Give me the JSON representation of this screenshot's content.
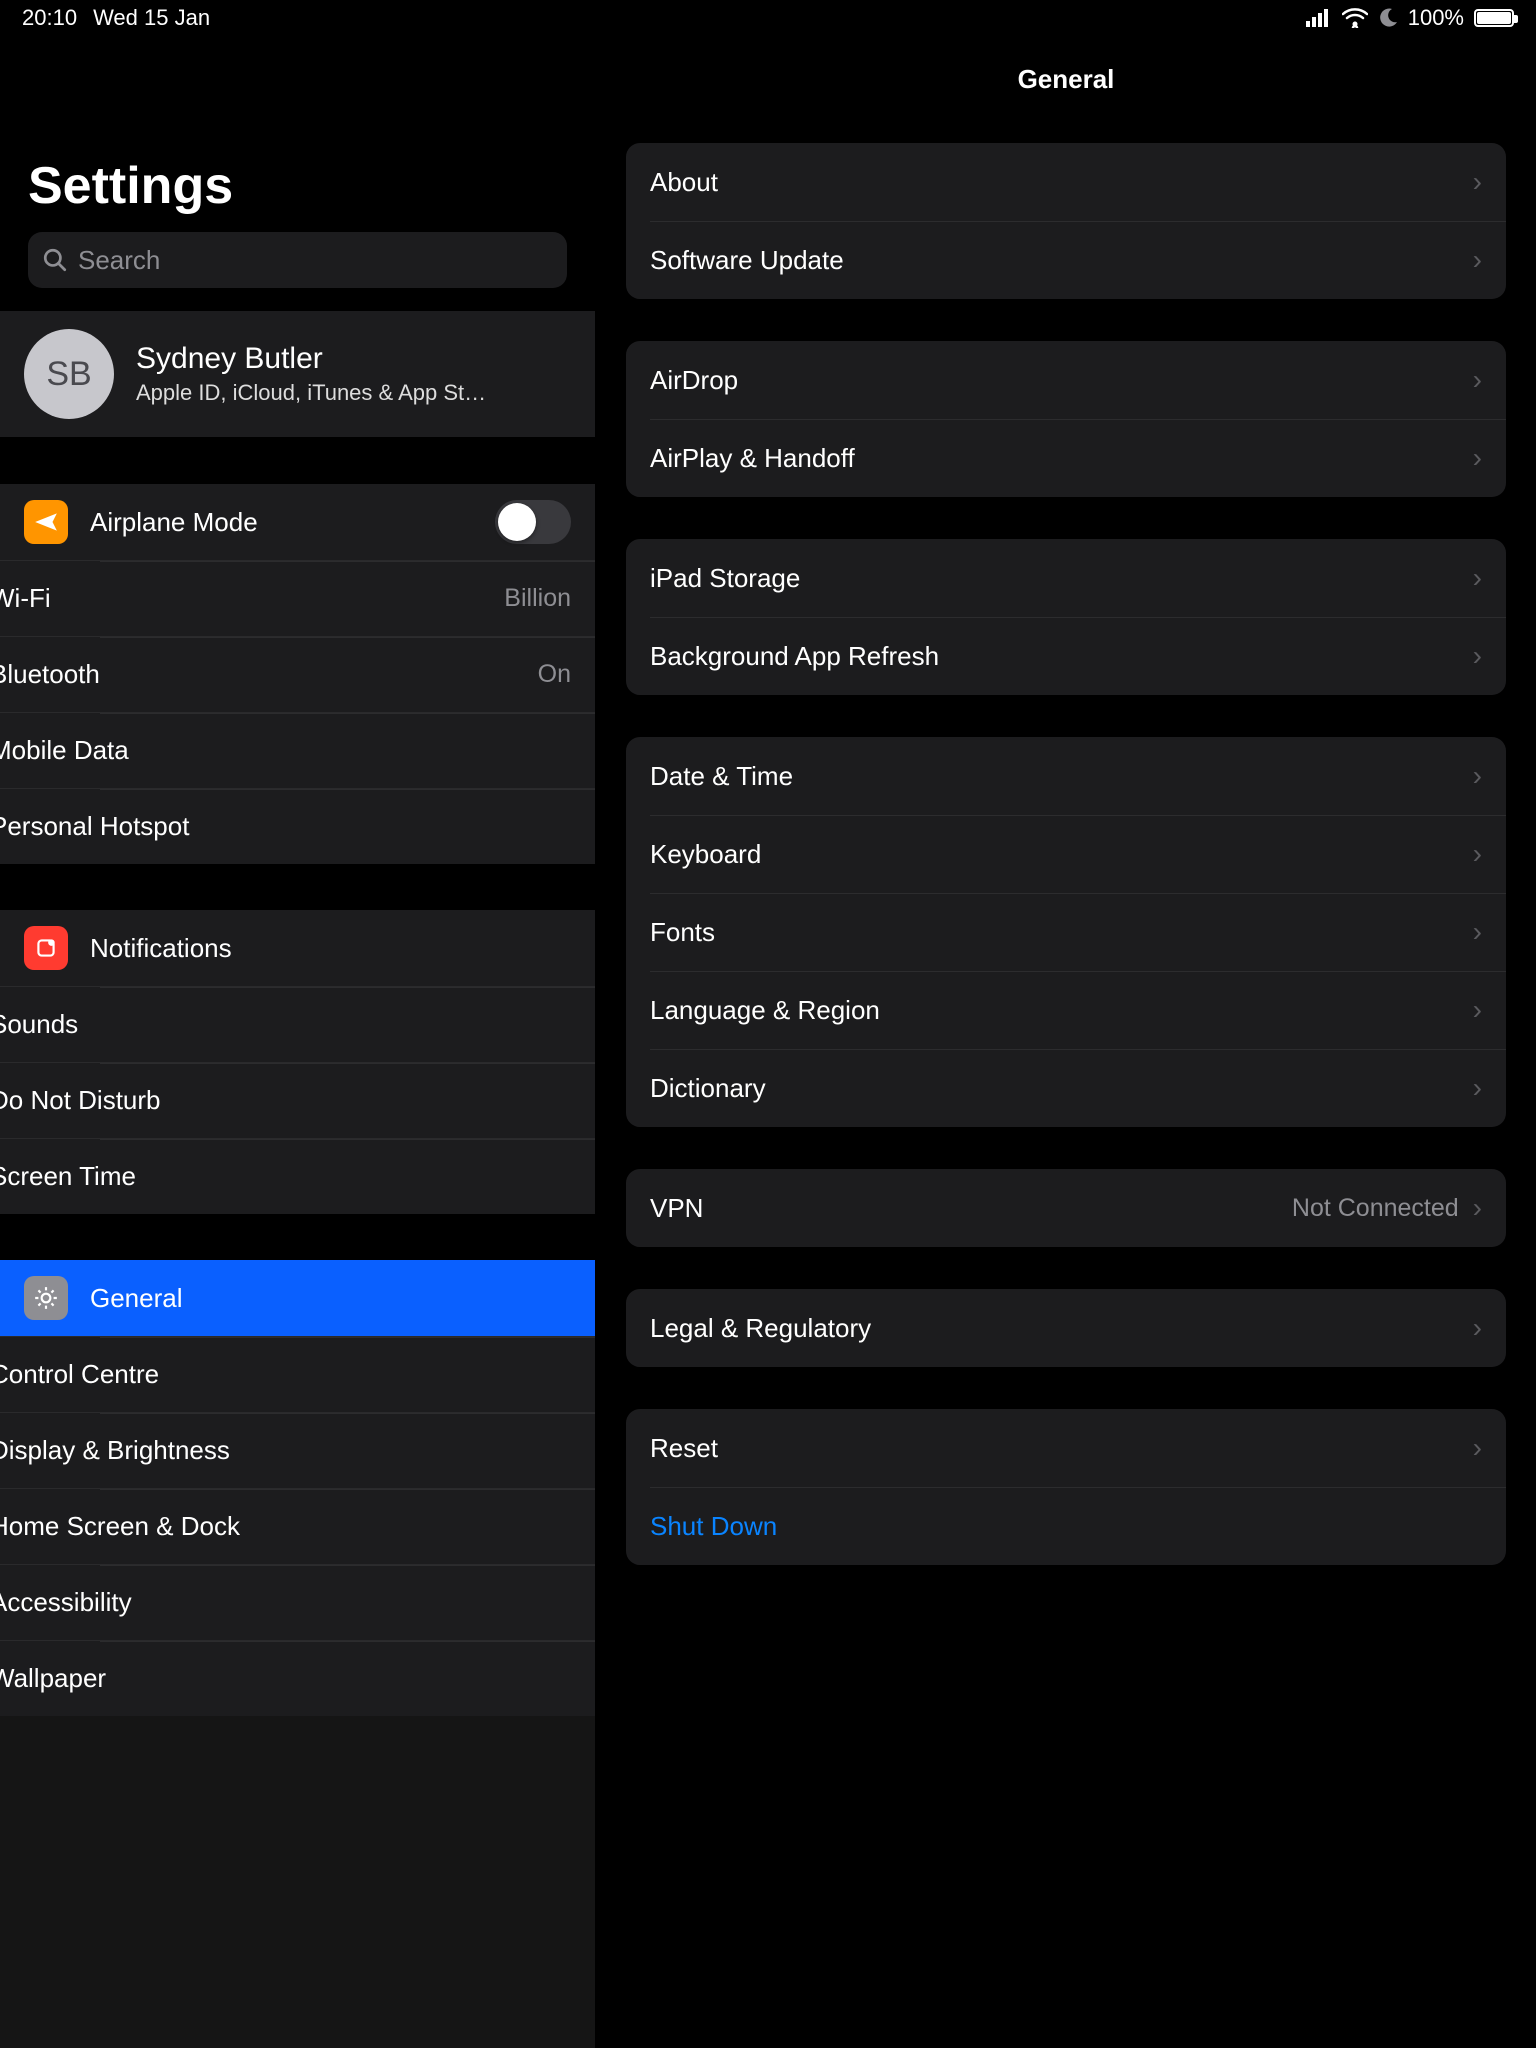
{
  "status": {
    "time": "20:10",
    "date": "Wed 15 Jan",
    "battery_pct": "100%",
    "battery_fill_pct": 100
  },
  "sidebar": {
    "title": "Settings",
    "search_placeholder": "Search",
    "profile": {
      "initials": "SB",
      "name": "Sydney Butler",
      "subtitle": "Apple ID, iCloud, iTunes & App St…"
    },
    "g1": {
      "airplane": "Airplane Mode",
      "wifi": "Wi-Fi",
      "wifi_value": "Billion",
      "bluetooth": "Bluetooth",
      "bluetooth_value": "On",
      "mobile": "Mobile Data",
      "hotspot": "Personal Hotspot"
    },
    "g2": {
      "notifications": "Notifications",
      "sounds": "Sounds",
      "dnd": "Do Not Disturb",
      "screentime": "Screen Time"
    },
    "g3": {
      "general": "General",
      "control": "Control Centre",
      "display": "Display & Brightness",
      "homescreen": "Home Screen & Dock",
      "accessibility": "Accessibility",
      "wallpaper": "Wallpaper"
    }
  },
  "detail": {
    "title": "General",
    "g1": {
      "about": "About",
      "software": "Software Update"
    },
    "g2": {
      "airdrop": "AirDrop",
      "airplay": "AirPlay & Handoff"
    },
    "g3": {
      "storage": "iPad Storage",
      "bgrefresh": "Background App Refresh"
    },
    "g4": {
      "datetime": "Date & Time",
      "keyboard": "Keyboard",
      "fonts": "Fonts",
      "language": "Language & Region",
      "dictionary": "Dictionary"
    },
    "g5": {
      "vpn": "VPN",
      "vpn_value": "Not Connected"
    },
    "g6": {
      "legal": "Legal & Regulatory"
    },
    "g7": {
      "reset": "Reset",
      "shutdown": "Shut Down"
    }
  }
}
